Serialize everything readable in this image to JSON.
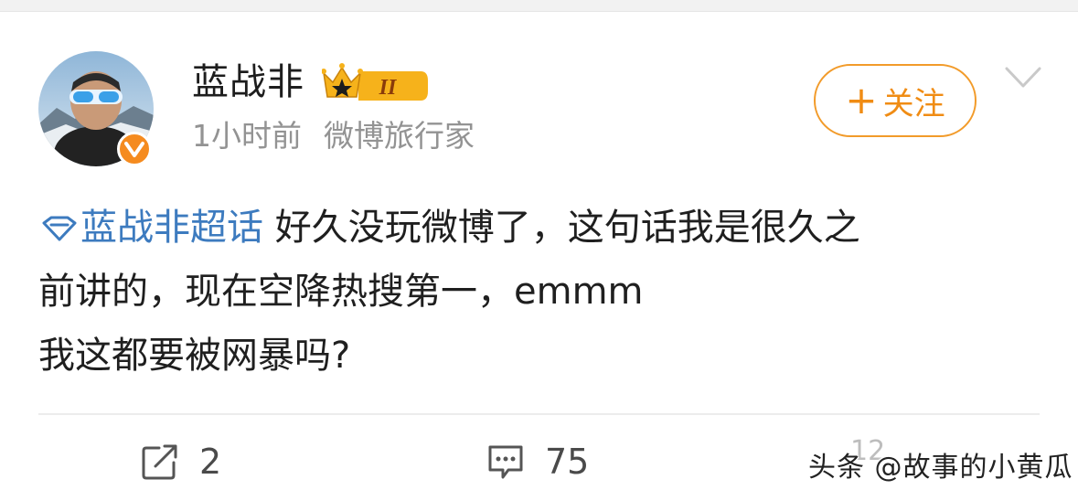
{
  "post": {
    "author": "蓝战非",
    "level_badge": "II",
    "time": "1小时前",
    "tag": "微博旅行家",
    "follow_label": "关注",
    "follow_plus": "+",
    "topic": "蓝战非超话",
    "text_line1": "好久没玩微博了，这句话我是很久之",
    "text_line2": "前讲的，现在空降热搜第一，emmm",
    "text_line3": "我这都要被网暴吗?",
    "actions": {
      "repost_count": "2",
      "comment_count": "75",
      "like_count_partial": "12"
    }
  },
  "watermark": "头条 @故事的小黄瓜",
  "colors": {
    "accent_orange": "#f08c14",
    "topic_blue": "#3d7bbf",
    "meta_gray": "#939393"
  },
  "icons": [
    "user-avatar",
    "verified-badge-icon",
    "crown-level-icon",
    "chevron-down-icon",
    "topic-diamond-icon",
    "repost-icon",
    "comment-icon"
  ]
}
